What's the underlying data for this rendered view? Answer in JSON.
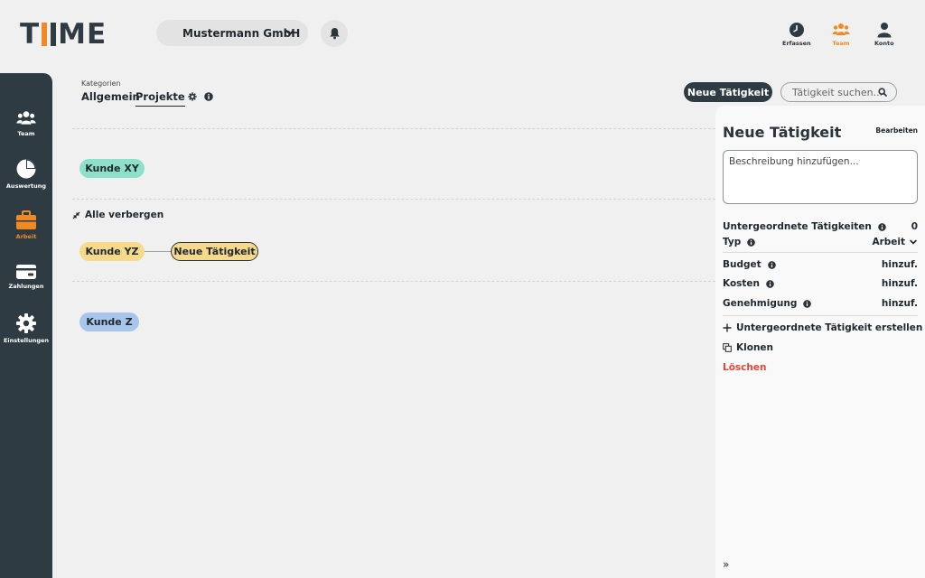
{
  "app": {
    "logo_text_left": "T",
    "logo_text_right": "ME"
  },
  "header": {
    "company": "Mustermann GmbH",
    "nav": [
      {
        "label": "Erfassen",
        "icon": "clock-icon"
      },
      {
        "label": "Team",
        "icon": "team-icon",
        "active": true
      },
      {
        "label": "Konto",
        "icon": "user-icon"
      }
    ]
  },
  "sidebar": {
    "items": [
      {
        "label": "Team",
        "icon": "team-icon"
      },
      {
        "label": "Auswertung",
        "icon": "pie-chart-icon"
      },
      {
        "label": "Arbeit",
        "icon": "briefcase-icon",
        "active": true
      },
      {
        "label": "Zahlungen",
        "icon": "card-icon"
      },
      {
        "label": "Einstellungen",
        "icon": "gear-icon"
      }
    ]
  },
  "categories": {
    "label": "Kategorien",
    "tabs": [
      "Allgemein",
      "Projekte"
    ],
    "active_tab": "Projekte"
  },
  "toolbar": {
    "new_activity": "Neue Tätigkeit",
    "search_placeholder": "Tätigkeit suchen..."
  },
  "canvas": {
    "hide_all": "Alle verbergen",
    "nodes": [
      {
        "label": "Kunde XY",
        "color": "#8fe0c8"
      },
      {
        "label": "Kunde YZ",
        "color": "#f7d98c"
      },
      {
        "label": "Neue Tätigkeit",
        "color": "#f7d98c"
      },
      {
        "label": "Kunde Z",
        "color": "#a8c6ec"
      }
    ]
  },
  "panel": {
    "title": "Neue Tätigkeit",
    "edit": "Bearbeiten",
    "description_placeholder": "Beschreibung hinzufügen...",
    "rows": [
      {
        "label": "Untergeordnete Tätigkeiten",
        "value": "0"
      },
      {
        "label": "Typ",
        "value": "Arbeit"
      },
      {
        "label": "Budget",
        "value": "hinzuf."
      },
      {
        "label": "Kosten",
        "value": "hinzuf."
      },
      {
        "label": "Genehmigung",
        "value": "hinzuf."
      }
    ],
    "actions": {
      "create_child": "Untergeordnete Tätigkeit erstellen",
      "clone": "Klonen",
      "delete": "Löschen"
    },
    "collapse": "»"
  },
  "colors": {
    "accent": "#f08a24",
    "dark": "#2e3b42",
    "danger": "#e2453b"
  }
}
